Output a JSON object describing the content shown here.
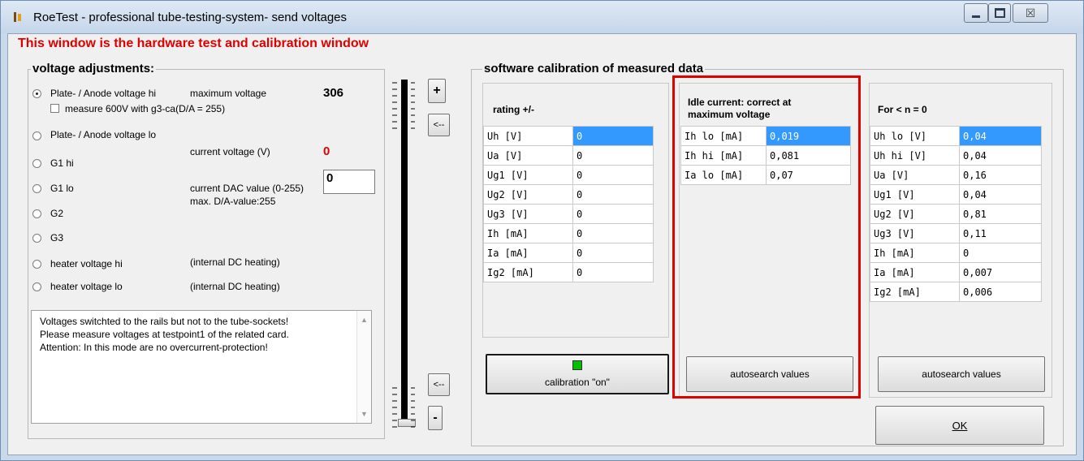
{
  "window": {
    "title": "RoeTest - professional tube-testing-system- send voltages",
    "caption_min": "–",
    "caption_max": "□",
    "caption_close": "☒"
  },
  "banner": "This window is the hardware test and calibration window",
  "voltage": {
    "group_title": "voltage adjustments:",
    "options": [
      "Plate- / Anode voltage hi",
      "Plate- / Anode voltage lo",
      "G1 hi",
      "G1 lo",
      "G2",
      "G3",
      "heater voltage hi",
      "heater voltage lo"
    ],
    "selected_index": 0,
    "checkbox_label": "measure 600V with g3-ca(D/A = 255)",
    "max_label": "maximum voltage",
    "max_value": "306",
    "cur_label": "current voltage (V)",
    "cur_value": "0",
    "dac_label": "current DAC value (0-255)",
    "dac_value": "0",
    "dac_max": "max. D/A-value:255",
    "heater_note_1": "(internal DC heating)",
    "heater_note_2": "(internal DC heating)",
    "memo_lines": [
      "Voltages switchted to the rails but not to the tube-sockets!",
      "Please measure voltages at testpoint1 of the related card.",
      "Attention: In this mode are no overcurrent-protection!"
    ]
  },
  "slider": {
    "plus": "+",
    "back_top": "<--",
    "back_bottom": "<--",
    "minus": "-",
    "level": 0
  },
  "calibration": {
    "group_title": "software calibration of measured data",
    "rating": {
      "heading": "rating +/-",
      "rows": [
        [
          "Uh [V]",
          "0"
        ],
        [
          "Ua [V]",
          "0"
        ],
        [
          "Ug1 [V]",
          "0"
        ],
        [
          "Ug2 [V]",
          "0"
        ],
        [
          "Ug3 [V]",
          "0"
        ],
        [
          "Ih [mA]",
          "0"
        ],
        [
          "Ia [mA]",
          "0"
        ],
        [
          "Ig2 [mA]",
          "0"
        ]
      ],
      "button": "calibration \"on\"",
      "led_color": "#00c000"
    },
    "idle": {
      "heading_1": "Idle current: correct at",
      "heading_2": "maximum voltage",
      "rows": [
        [
          "Ih lo [mA]",
          "0,019"
        ],
        [
          "Ih hi [mA]",
          "0,081"
        ],
        [
          "Ia lo [mA]",
          "0,07"
        ]
      ],
      "button": "autosearch values",
      "highlight_color": "#e00000"
    },
    "n0": {
      "heading": "For < n = 0",
      "rows": [
        [
          "Uh lo [V]",
          "0,04"
        ],
        [
          "Uh hi [V]",
          "0,04"
        ],
        [
          "Ua [V]",
          "0,16"
        ],
        [
          "Ug1 [V]",
          "0,04"
        ],
        [
          "Ug2 [V]",
          "0,81"
        ],
        [
          "Ug3 [V]",
          "0,11"
        ],
        [
          "Ih [mA]",
          "0"
        ],
        [
          "Ia [mA]",
          "0,007"
        ],
        [
          "Ig2 [mA]",
          "0,006"
        ]
      ],
      "button": "autosearch values"
    }
  },
  "ok_label": "OK",
  "colors": {
    "selection": "#3399ff",
    "banner_red": "#e00000",
    "current_voltage_red": "#e00000"
  }
}
